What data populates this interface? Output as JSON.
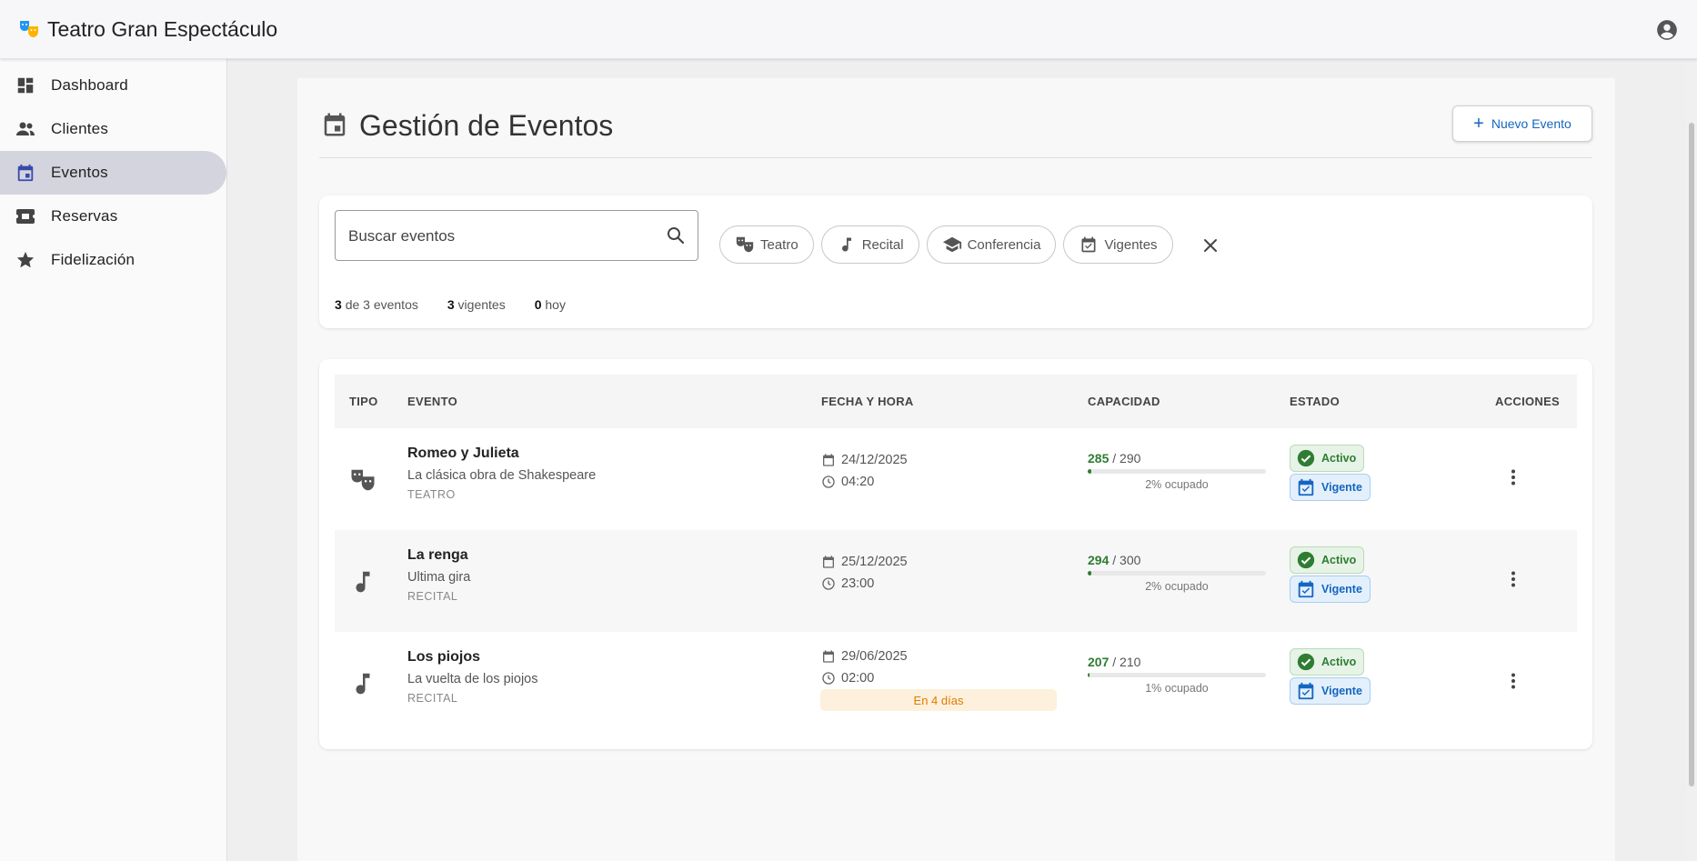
{
  "app": {
    "title": "Teatro Gran Espectáculo"
  },
  "sidebar": {
    "items": [
      {
        "label": "Dashboard",
        "icon": "dashboard-icon"
      },
      {
        "label": "Clientes",
        "icon": "people-icon"
      },
      {
        "label": "Eventos",
        "icon": "calendar-icon",
        "active": true
      },
      {
        "label": "Reservas",
        "icon": "ticket-icon"
      },
      {
        "label": "Fidelización",
        "icon": "star-icon"
      }
    ]
  },
  "page": {
    "title": "Gestión de Eventos",
    "new_button": "Nuevo Evento"
  },
  "filters": {
    "search_placeholder": "Buscar eventos",
    "chips": [
      {
        "label": "Teatro",
        "icon": "theater-masks-icon"
      },
      {
        "label": "Recital",
        "icon": "music-note-icon"
      },
      {
        "label": "Conferencia",
        "icon": "school-icon"
      },
      {
        "label": "Vigentes",
        "icon": "event-available-icon"
      }
    ]
  },
  "stats": {
    "shown": "3",
    "shown_suffix": "de 3 eventos",
    "vigentes": "3",
    "vigentes_suffix": "vigentes",
    "hoy": "0",
    "hoy_suffix": "hoy"
  },
  "table": {
    "headers": [
      "TIPO",
      "EVENTO",
      "FECHA Y HORA",
      "CAPACIDAD",
      "ESTADO",
      "ACCIONES"
    ],
    "rows": [
      {
        "type_icon": "theater-masks-icon",
        "name": "Romeo y Julieta",
        "description": "La clásica obra de Shakespeare",
        "category": "TEATRO",
        "date": "24/12/2025",
        "time": "04:20",
        "note": "",
        "sold": "285",
        "capacity": "/ 290",
        "fill_percent": 2,
        "occupancy": "2% ocupado",
        "status": "Activo",
        "validity": "Vigente"
      },
      {
        "type_icon": "music-note-icon",
        "name": "La renga",
        "description": "Ultima gira",
        "category": "RECITAL",
        "date": "25/12/2025",
        "time": "23:00",
        "note": "",
        "sold": "294",
        "capacity": "/ 300",
        "fill_percent": 2,
        "occupancy": "2% ocupado",
        "status": "Activo",
        "validity": "Vigente"
      },
      {
        "type_icon": "music-note-icon",
        "name": "Los piojos",
        "description": "La vuelta de los piojos",
        "category": "RECITAL",
        "date": "29/06/2025",
        "time": "02:00",
        "note": "En 4 días",
        "sold": "207",
        "capacity": "/ 210",
        "fill_percent": 1,
        "occupancy": "1% ocupado",
        "status": "Activo",
        "validity": "Vigente"
      }
    ]
  },
  "colors": {
    "accent": "#1565c0",
    "success": "#2e7d32",
    "warning": "#e07b00",
    "active_nav": "#d4d4de"
  }
}
